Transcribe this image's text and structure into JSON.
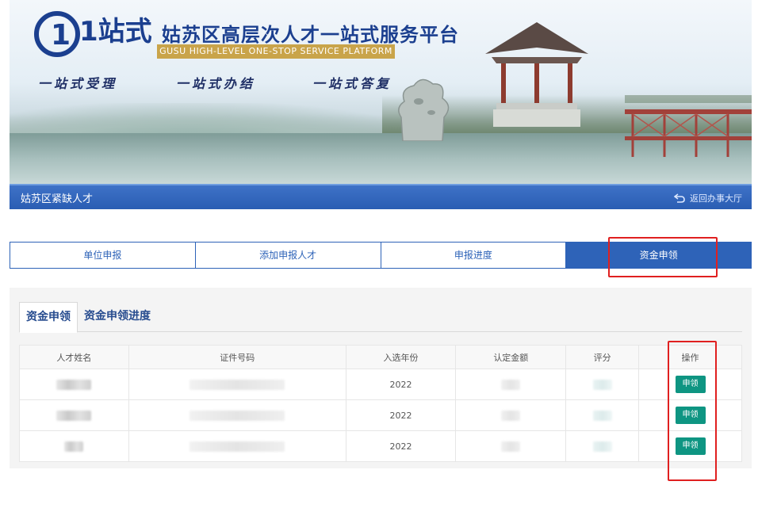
{
  "banner": {
    "logo_mark": "1站式",
    "title": "姑苏区高层次人才一站式服务平台",
    "subtitle": "GUSU HIGH-LEVEL ONE-STOP SERVICE PLATFORM",
    "slogans": [
      "一站式受理",
      "一站式办结",
      "一站式答复"
    ]
  },
  "titlebar": {
    "page_title": "姑苏区紧缺人才",
    "back_label": "返回办事大厅"
  },
  "main_tabs": [
    {
      "label": "单位申报",
      "active": false
    },
    {
      "label": "添加申报人才",
      "active": false
    },
    {
      "label": "申报进度",
      "active": false
    },
    {
      "label": "资金申领",
      "active": true
    }
  ],
  "sub_tabs": [
    {
      "label": "资金申领",
      "active": true
    },
    {
      "label": "资金申领进度",
      "active": false
    }
  ],
  "table": {
    "columns": [
      "人才姓名",
      "证件号码",
      "入选年份",
      "认定金额",
      "评分",
      "操作"
    ],
    "rows": [
      {
        "year": "2022",
        "action": "申领"
      },
      {
        "year": "2022",
        "action": "申领"
      },
      {
        "year": "2022",
        "action": "申领"
      }
    ]
  },
  "colors": {
    "brand_blue": "#2e63b8",
    "action_green": "#0e9582",
    "highlight_red": "#e02020"
  }
}
